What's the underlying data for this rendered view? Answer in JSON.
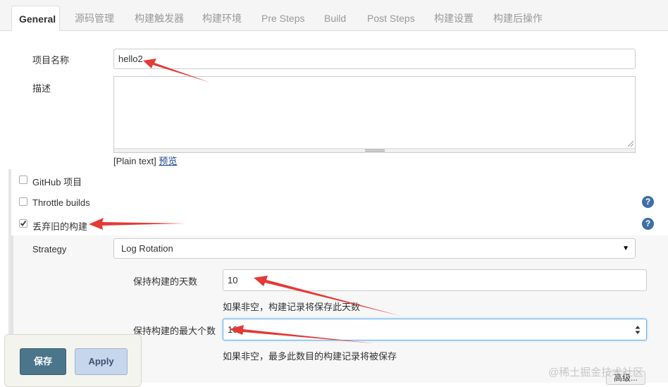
{
  "tabs": [
    {
      "label": "General",
      "active": true
    },
    {
      "label": "源码管理"
    },
    {
      "label": "构建触发器"
    },
    {
      "label": "构建环境"
    },
    {
      "label": "Pre Steps"
    },
    {
      "label": "Build"
    },
    {
      "label": "Post Steps"
    },
    {
      "label": "构建设置"
    },
    {
      "label": "构建后操作"
    }
  ],
  "form": {
    "project_name_label": "项目名称",
    "project_name_value": "hello2",
    "description_label": "描述",
    "plain_text": "[Plain text]",
    "preview_link": "预览",
    "github_label": "GitHub 项目",
    "throttle_label": "Throttle builds",
    "discard_label": "丢弃旧的构建",
    "strategy_label": "Strategy",
    "strategy_value": "Log Rotation",
    "days_label": "保持构建的天数",
    "days_value": "10",
    "days_hint": "如果非空，构建记录将保存此天数",
    "max_label": "保持构建的最大个数",
    "max_value": "10",
    "max_hint": "如果非空，最多此数目的构建记录将被保存",
    "advanced_label": "高级..."
  },
  "help_icon_glyph": "?",
  "buttons": {
    "save": "保存",
    "apply": "Apply"
  },
  "watermark": "@稀土掘金技术社区",
  "colors": {
    "arrow": "#e53935",
    "save_bg": "#4b758b",
    "apply_bg": "#c6d6ec",
    "help_bg": "#3e6fa5"
  }
}
